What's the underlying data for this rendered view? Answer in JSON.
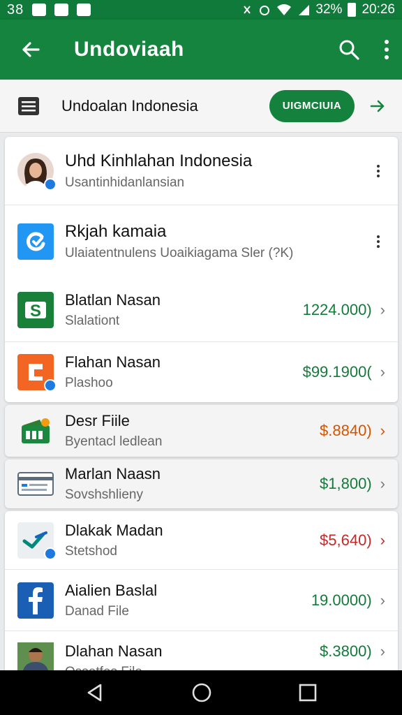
{
  "status": {
    "left_time": "38",
    "battery": "32%",
    "time": "20:26"
  },
  "appbar": {
    "title": "Undoviaah"
  },
  "subheader": {
    "title": "Undoalan Indonesia",
    "pill_label": "UIGMCIUIA"
  },
  "list": [
    {
      "title": "Uhd Kinhlahan Indonesia",
      "subtitle": "Usantinhidanlansian",
      "amount": "",
      "amount_color": "",
      "icon": "profile-photo-avatar"
    },
    {
      "title": "Rkjah kamaia",
      "subtitle": "Ulaiatentnulens Uoaikiagama Sler (?K)",
      "amount": "",
      "amount_color": "",
      "icon": "blue-app-icon"
    },
    {
      "title": "Blatlan Nasan",
      "subtitle": "Slalationt",
      "amount": "1224.000)",
      "amount_color": "#137a3a",
      "icon": "green-s-app-icon"
    },
    {
      "title": "Flahan Nasan",
      "subtitle": "Plashoo",
      "amount": "$99.1900(",
      "amount_color": "#137a3a",
      "icon": "orange-app-icon"
    },
    {
      "title": "Desr Fiile",
      "subtitle": "Byentacl ledlean",
      "amount": "$.8840)",
      "amount_color": "#d35400",
      "icon": "green-wallet-icon"
    },
    {
      "title": "Marlan Naasn",
      "subtitle": "Sovshshlieny",
      "amount": "$1,800)",
      "amount_color": "#137a3a",
      "icon": "card-icon"
    },
    {
      "title": "Dlakak Madan",
      "subtitle": "Stetshod",
      "amount": "$5,640)",
      "amount_color": "#c62828",
      "icon": "chart-app-icon"
    },
    {
      "title": "Aialien Baslal",
      "subtitle": "Danad File",
      "amount": "19.0000)",
      "amount_color": "#137a3a",
      "icon": "facebook-icon"
    },
    {
      "title": "Dlahan Nasan",
      "subtitle": "Ossetfes File",
      "amount": "$.3800)",
      "amount_color": "#137a3a",
      "icon": "person-photo-avatar"
    }
  ],
  "colors": {
    "primary": "#15843f",
    "status_bar": "#0f7a3a",
    "accent_blue": "#1f7ae0"
  }
}
